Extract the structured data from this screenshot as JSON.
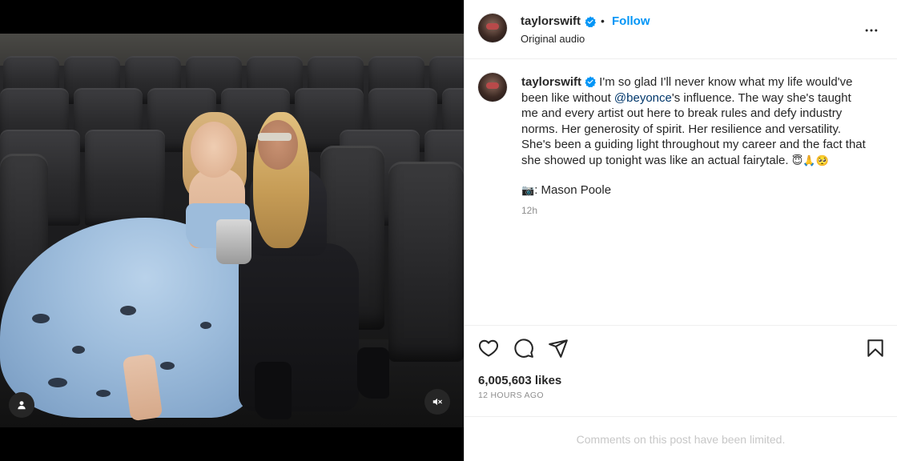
{
  "post": {
    "author": "taylorswift",
    "follow_label": "Follow",
    "dot": "•",
    "audio": "Original audio"
  },
  "caption": {
    "username": "taylorswift",
    "text_before_mention": " I'm so glad I'll never know what my life would've been like without ",
    "mention": "@beyonce",
    "text_after_mention": "'s influence. The way she's taught me and every artist out here to break rules and defy industry norms. Her generosity of spirit. Her resilience and versatility. She's been a guiding light throughout my career and the fact that she showed up tonight was like an actual fairytale. ",
    "emojis": "😇🙏🥺",
    "credit_emoji": "📷",
    "credit": ": Mason Poole",
    "time": "12h"
  },
  "engagement": {
    "likes": "6,005,603 likes",
    "posted_ago": "12 HOURS AGO",
    "comments_notice": "Comments on this post have been limited."
  },
  "icons": {
    "like": "heart-icon",
    "comment": "comment-bubble-icon",
    "share": "paper-plane-icon",
    "save": "bookmark-icon",
    "more": "more-options-icon",
    "verified": "verified-badge-icon",
    "tagged_user": "user-tag-icon",
    "mute": "muted-speaker-icon"
  },
  "colors": {
    "link_blue": "#0095f6",
    "mention": "#00376b",
    "verified_blue": "#0095f6",
    "secondary_text": "#8e8e8e",
    "disabled_text": "#c7c7c7"
  }
}
